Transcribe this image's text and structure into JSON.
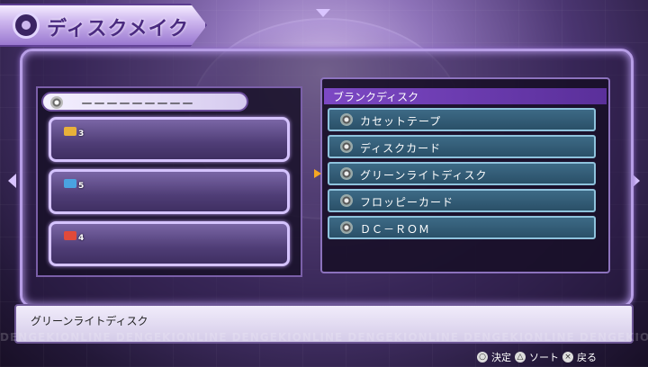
{
  "header": {
    "title": "ディスクメイク"
  },
  "left_panel": {
    "header_text": "ーーーーーーーーー",
    "slots": [
      {
        "num": "3",
        "color": "#e8b13a"
      },
      {
        "num": "5",
        "color": "#4aa3e0"
      },
      {
        "num": "4",
        "color": "#e04a3a"
      }
    ]
  },
  "right_panel": {
    "header": "ブランクディスク",
    "items": [
      {
        "label": "カセットテープ"
      },
      {
        "label": "ディスクカード"
      },
      {
        "label": "グリーンライトディスク"
      },
      {
        "label": "フロッピーカード"
      },
      {
        "label": "ＤＣ－ＲＯＭ"
      }
    ],
    "selected_index": 2
  },
  "description": "グリーンライトディスク",
  "watermark": "DENGEKIONLINE DENGEKIONLINE DENGEKIONLINE DENGEKIONLINE DENGEKIONLINE DENGEKIONLINE",
  "controls": {
    "confirm_icon": "○",
    "confirm_label": "決定",
    "sort_icon": "△",
    "sort_label": "ソート",
    "back_icon": "×",
    "back_label": "戻る"
  }
}
